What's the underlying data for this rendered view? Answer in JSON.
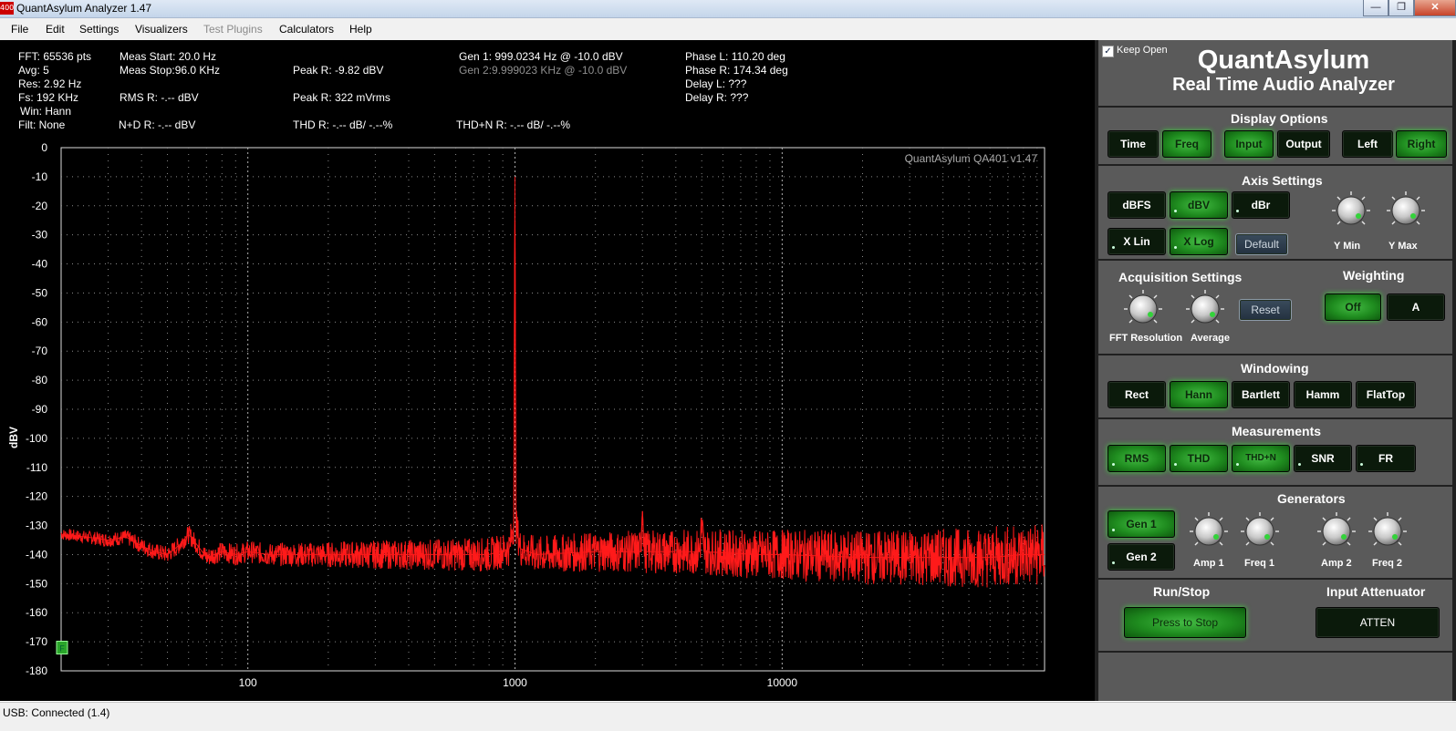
{
  "window": {
    "title": "QuantAsylum Analyzer 1.47",
    "icon_text": "400"
  },
  "menu": [
    {
      "label": "File",
      "enabled": true
    },
    {
      "label": "Edit",
      "enabled": true
    },
    {
      "label": "Settings",
      "enabled": true
    },
    {
      "label": "Visualizers",
      "enabled": true
    },
    {
      "label": "Test Plugins",
      "enabled": false
    },
    {
      "label": "Calculators",
      "enabled": true
    },
    {
      "label": "Help",
      "enabled": true
    }
  ],
  "readouts": {
    "fft": "FFT: 65536 pts",
    "avg": "Avg: 5",
    "res": "Res: 2.92 Hz",
    "fs": "Fs: 192 KHz",
    "win": "Win: Hann",
    "filt": "Filt: None",
    "meas_start": "Meas Start: 20.0 Hz",
    "meas_stop": "Meas Stop:96.0 KHz",
    "rms_r": "RMS R: -.-- dBV",
    "nd_r": "N+D R: -.-- dBV",
    "peak_r_dbv": "Peak R: -9.82 dBV",
    "peak_r_mvrms": "Peak R: 322 mVrms",
    "thd_r": "THD R: -.-- dB/ -.--%",
    "gen1": "Gen 1: 999.0234 Hz @ -10.0  dBV",
    "gen2": "Gen 2:9.999023 KHz @ -10.0  dBV",
    "thdn_r": "THD+N R: -.-- dB/ -.--%",
    "phase_l": "Phase L: 110.20 deg",
    "phase_r": "Phase R: 174.34 deg",
    "delay_l": "Delay L: ???",
    "delay_r": "Delay R: ???"
  },
  "chart_data": {
    "type": "line",
    "watermark": "QuantAsylum QA401 v1.47",
    "ylabel": "dBV",
    "xlabel": "",
    "xscale": "log",
    "xlim": [
      20,
      96000
    ],
    "ylim": [
      -180,
      0
    ],
    "yticks": [
      0,
      -10,
      -20,
      -30,
      -40,
      -50,
      -60,
      -70,
      -80,
      -90,
      -100,
      -110,
      -120,
      -130,
      -140,
      -150,
      -160,
      -170,
      -180
    ],
    "xticks": [
      100,
      1000,
      10000
    ],
    "grid": true,
    "series": [
      {
        "color": "#ff1a1a",
        "points": [
          [
            20,
            -133
          ],
          [
            25,
            -134
          ],
          [
            30,
            -135
          ],
          [
            35,
            -134
          ],
          [
            40,
            -137
          ],
          [
            45,
            -139
          ],
          [
            50,
            -140
          ],
          [
            55,
            -137
          ],
          [
            60,
            -133
          ],
          [
            65,
            -137
          ],
          [
            70,
            -141
          ],
          [
            80,
            -139
          ],
          [
            90,
            -140
          ],
          [
            100,
            -139
          ],
          [
            120,
            -140
          ],
          [
            150,
            -140
          ],
          [
            200,
            -140
          ],
          [
            300,
            -140
          ],
          [
            500,
            -140
          ],
          [
            800,
            -140
          ],
          [
            950,
            -138
          ],
          [
            990,
            -130
          ],
          [
            999,
            -10
          ],
          [
            1008,
            -130
          ],
          [
            1050,
            -138
          ],
          [
            1200,
            -140
          ],
          [
            2000,
            -139
          ],
          [
            2950,
            -139
          ],
          [
            3000,
            -125
          ],
          [
            3050,
            -139
          ],
          [
            4900,
            -139
          ],
          [
            5000,
            -130
          ],
          [
            5100,
            -139
          ],
          [
            8000,
            -140
          ],
          [
            10000,
            -140
          ],
          [
            20000,
            -141
          ],
          [
            40000,
            -141
          ],
          [
            60000,
            -141
          ],
          [
            80000,
            -140
          ],
          [
            96000,
            -140
          ]
        ]
      }
    ],
    "marker_label": "F"
  },
  "panel": {
    "keep_open": {
      "label": "Keep Open",
      "checked": true
    },
    "brand": "QuantAsylum",
    "subtitle": "Real Time Audio Analyzer",
    "display": {
      "title": "Display Options",
      "buttons": [
        {
          "label": "Time",
          "on": false
        },
        {
          "label": "Freq",
          "on": true
        },
        {
          "label": "Input",
          "on": true
        },
        {
          "label": "Output",
          "on": false
        },
        {
          "label": "Left",
          "on": false
        },
        {
          "label": "Right",
          "on": true
        }
      ]
    },
    "axis": {
      "title": "Axis Settings",
      "buttons": [
        {
          "label": "dBFS",
          "on": false
        },
        {
          "label": "dBV",
          "on": true
        },
        {
          "label": "dBr",
          "on": false
        },
        {
          "label": "X Lin",
          "on": false
        },
        {
          "label": "X Log",
          "on": true
        }
      ],
      "default_label": "Default",
      "ymin_label": "Y Min",
      "ymax_label": "Y Max"
    },
    "acquisition": {
      "title": "Acquisition Settings",
      "reset_label": "Reset",
      "fft_label": "FFT Resolution",
      "avg_label": "Average"
    },
    "weighting": {
      "title": "Weighting",
      "buttons": [
        {
          "label": "Off",
          "on": true
        },
        {
          "label": "A",
          "on": false
        }
      ]
    },
    "windowing": {
      "title": "Windowing",
      "buttons": [
        {
          "label": "Rect",
          "on": false
        },
        {
          "label": "Hann",
          "on": true
        },
        {
          "label": "Bartlett",
          "on": false
        },
        {
          "label": "Hamm",
          "on": false
        },
        {
          "label": "FlatTop",
          "on": false
        }
      ]
    },
    "measurements": {
      "title": "Measurements",
      "buttons": [
        {
          "label": "RMS",
          "on": true
        },
        {
          "label": "THD",
          "on": true
        },
        {
          "label": "THD+N",
          "on": true
        },
        {
          "label": "SNR",
          "on": false
        },
        {
          "label": "FR",
          "on": false
        }
      ]
    },
    "generators": {
      "title": "Generators",
      "gen1": {
        "label": "Gen 1",
        "on": true
      },
      "gen2": {
        "label": "Gen 2",
        "on": false
      },
      "knobs": [
        "Amp 1",
        "Freq 1",
        "Amp 2",
        "Freq 2"
      ]
    },
    "runstop": {
      "title": "Run/Stop",
      "button": "Press to Stop"
    },
    "attenuator": {
      "title": "Input Attenuator",
      "button": "ATTEN"
    }
  },
  "status": {
    "text": "USB: Connected  (1.4)"
  },
  "colors": {
    "trace": "#ff1a1a",
    "grid": "#8a8a8a",
    "active_button": "#2fa82f",
    "panel_bg": "#5a5a5a"
  }
}
